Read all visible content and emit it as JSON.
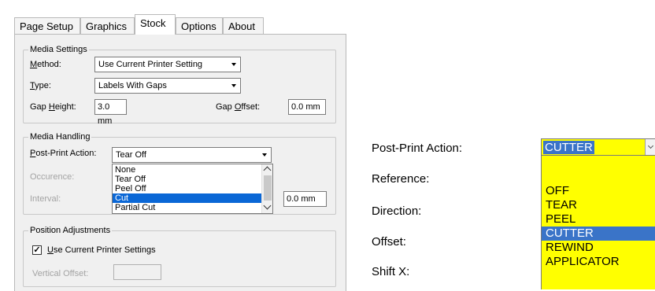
{
  "left_dialog": {
    "tabs": [
      "Page Setup",
      "Graphics",
      "Stock",
      "Options",
      "About"
    ],
    "active_tab": "Stock",
    "media_settings": {
      "title": "Media Settings",
      "method_label": "Method:",
      "method_value": "Use Current Printer Setting",
      "type_label": "Type:",
      "type_value": "Labels With Gaps",
      "gap_height_label": "Gap Height:",
      "gap_height_value": "3.0 mm",
      "gap_offset_label": "Gap Offset:",
      "gap_offset_value": "0.0 mm"
    },
    "media_handling": {
      "title": "Media Handling",
      "post_print_label": "Post-Print Action:",
      "post_print_value": "Tear Off",
      "occurrence_label": "Occurence:",
      "interval_label": "Interval:",
      "interval_value": "0.0 mm",
      "dropdown_options": [
        "None",
        "Tear Off",
        "Peel Off",
        "Cut",
        "Partial Cut"
      ],
      "dropdown_selected": "Cut"
    },
    "position_adjustments": {
      "title": "Position Adjustments",
      "use_current_label": "Use Current Printer Settings",
      "use_current_checked": true,
      "vertical_offset_label": "Vertical Offset:"
    }
  },
  "right_panel": {
    "labels": [
      "Post-Print Action:",
      "Reference:",
      "Direction:",
      "Offset:",
      "Shift X:"
    ],
    "combo_value": "CUTTER",
    "options": [
      "OFF",
      "TEAR",
      "PEEL",
      "CUTTER",
      "REWIND",
      "APPLICATOR"
    ],
    "selected": "CUTTER",
    "highlight_color": "#ffff00",
    "selection_color": "#3a74c8"
  }
}
